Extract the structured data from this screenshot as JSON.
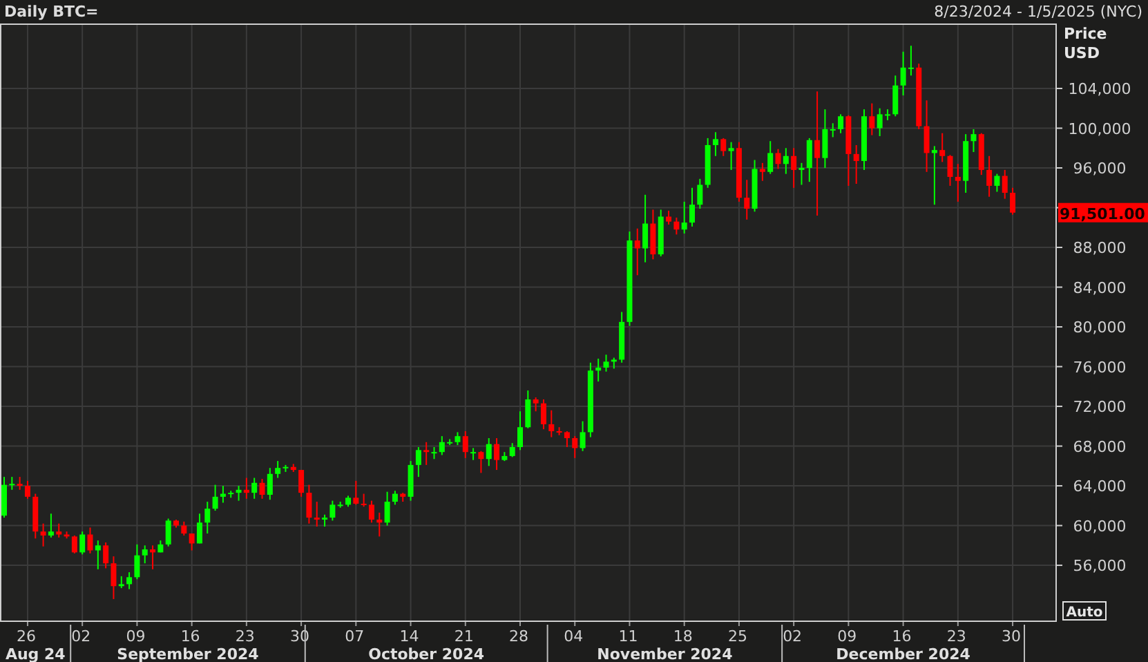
{
  "header": {
    "title": "Daily BTC=",
    "date_range": "8/23/2024 - 1/5/2025 (NYC)"
  },
  "price_axis": {
    "title": "Price",
    "unit": "USD",
    "last_price": "91,501.00"
  },
  "date_axis": {
    "months": [
      "Aug 24",
      "September 2024",
      "October 2024",
      "November 2024",
      "December 2024"
    ]
  },
  "auto_button": "Auto",
  "chart_data": {
    "type": "candlestick",
    "grid": true,
    "ylim": [
      50300,
      110540
    ],
    "yticks": [
      {
        "value": 104000,
        "label": "104,000"
      },
      {
        "value": 100000,
        "label": "100,000"
      },
      {
        "value": 96000,
        "label": "96,000"
      },
      {
        "value": 88000,
        "label": "88,000"
      },
      {
        "value": 84000,
        "label": "84,000"
      },
      {
        "value": 80000,
        "label": "80,000"
      },
      {
        "value": 76000,
        "label": "76,000"
      },
      {
        "value": 72000,
        "label": "72,000"
      },
      {
        "value": 68000,
        "label": "68,000"
      },
      {
        "value": 64000,
        "label": "64,000"
      },
      {
        "value": 60000,
        "label": "60,000"
      },
      {
        "value": 56000,
        "label": "56,000"
      }
    ],
    "categories": [
      null,
      null,
      null,
      "26",
      null,
      null,
      null,
      null,
      null,
      null,
      "02",
      null,
      null,
      null,
      null,
      null,
      null,
      "09",
      null,
      null,
      null,
      null,
      null,
      null,
      "16",
      null,
      null,
      null,
      null,
      null,
      null,
      "23",
      null,
      null,
      null,
      null,
      null,
      null,
      "30",
      null,
      null,
      null,
      null,
      null,
      null,
      "07",
      null,
      null,
      null,
      null,
      null,
      null,
      "14",
      null,
      null,
      null,
      null,
      null,
      null,
      "21",
      null,
      null,
      null,
      null,
      null,
      null,
      "28",
      null,
      null,
      null,
      null,
      null,
      null,
      "04",
      null,
      null,
      null,
      null,
      null,
      null,
      "11",
      null,
      null,
      null,
      null,
      null,
      null,
      "18",
      null,
      null,
      null,
      null,
      null,
      null,
      "25",
      null,
      null,
      null,
      null,
      null,
      null,
      "02",
      null,
      null,
      null,
      null,
      null,
      null,
      "09",
      null,
      null,
      null,
      null,
      null,
      null,
      "16",
      null,
      null,
      null,
      null,
      null,
      null,
      "23",
      null,
      null,
      null,
      null,
      null,
      null,
      "30"
    ],
    "ohlc": [
      [
        61000,
        64900,
        60800,
        64100
      ],
      [
        64100,
        64900,
        63600,
        64200
      ],
      [
        64200,
        64900,
        63600,
        64000
      ],
      [
        64000,
        64500,
        62700,
        62900
      ],
      [
        62900,
        63200,
        58700,
        59400
      ],
      [
        59400,
        60200,
        57900,
        59000
      ],
      [
        59000,
        61200,
        58800,
        59400
      ],
      [
        59400,
        60200,
        58800,
        59100
      ],
      [
        59100,
        59400,
        58700,
        58900
      ],
      [
        58900,
        59000,
        57200,
        57300
      ],
      [
        57300,
        59400,
        57100,
        59100
      ],
      [
        59100,
        59800,
        57200,
        57500
      ],
      [
        57500,
        58500,
        55600,
        58000
      ],
      [
        58000,
        58300,
        55700,
        56200
      ],
      [
        56200,
        56900,
        52600,
        53900
      ],
      [
        53900,
        54900,
        53700,
        54100
      ],
      [
        54100,
        55300,
        53600,
        54800
      ],
      [
        54800,
        58100,
        54600,
        57000
      ],
      [
        57000,
        58000,
        56200,
        57600
      ],
      [
        57600,
        58000,
        55600,
        57300
      ],
      [
        57300,
        58500,
        57300,
        58100
      ],
      [
        58100,
        60700,
        57900,
        60500
      ],
      [
        60500,
        60600,
        59800,
        60000
      ],
      [
        60000,
        60400,
        59000,
        59200
      ],
      [
        59200,
        59200,
        57500,
        58200
      ],
      [
        58200,
        61200,
        58200,
        60300
      ],
      [
        60300,
        62400,
        59200,
        61700
      ],
      [
        61700,
        64100,
        61500,
        62900
      ],
      [
        62900,
        64000,
        62300,
        63200
      ],
      [
        63200,
        63500,
        62800,
        63300
      ],
      [
        63300,
        64000,
        62500,
        63600
      ],
      [
        63600,
        64800,
        62700,
        63300
      ],
      [
        63300,
        64800,
        62700,
        64300
      ],
      [
        64300,
        64700,
        62700,
        63100
      ],
      [
        63100,
        65800,
        62600,
        65200
      ],
      [
        65200,
        66500,
        64800,
        65800
      ],
      [
        65800,
        66100,
        65400,
        65900
      ],
      [
        65900,
        66200,
        65400,
        65600
      ],
      [
        65600,
        65600,
        62900,
        63300
      ],
      [
        63300,
        64100,
        60200,
        60800
      ],
      [
        60800,
        62400,
        59900,
        60600
      ],
      [
        60600,
        61100,
        59900,
        60800
      ],
      [
        60800,
        62500,
        60500,
        62100
      ],
      [
        62100,
        62400,
        61800,
        62100
      ],
      [
        62100,
        63000,
        61900,
        62800
      ],
      [
        62800,
        64500,
        62100,
        62200
      ],
      [
        62200,
        63200,
        61900,
        62100
      ],
      [
        62100,
        62500,
        60300,
        60600
      ],
      [
        60600,
        61300,
        58900,
        60300
      ],
      [
        60300,
        63400,
        60000,
        62400
      ],
      [
        62400,
        63500,
        62100,
        63200
      ],
      [
        63200,
        63300,
        62400,
        62900
      ],
      [
        62900,
        66500,
        62500,
        66100
      ],
      [
        66100,
        67900,
        64900,
        67600
      ],
      [
        67600,
        68400,
        66100,
        67400
      ],
      [
        67400,
        67900,
        66700,
        67400
      ],
      [
        67400,
        69000,
        67100,
        68400
      ],
      [
        68400,
        68700,
        68100,
        68400
      ],
      [
        68400,
        69400,
        68100,
        69000
      ],
      [
        69000,
        69500,
        66800,
        67400
      ],
      [
        67400,
        67800,
        66600,
        67400
      ],
      [
        67400,
        67500,
        65300,
        66700
      ],
      [
        66700,
        68800,
        66000,
        68200
      ],
      [
        68200,
        68800,
        65600,
        66600
      ],
      [
        66600,
        67400,
        66500,
        67000
      ],
      [
        67000,
        68300,
        66900,
        67900
      ],
      [
        67900,
        71500,
        67600,
        69900
      ],
      [
        69900,
        73600,
        69800,
        72700
      ],
      [
        72700,
        72900,
        71500,
        72300
      ],
      [
        72300,
        72700,
        69700,
        70200
      ],
      [
        70200,
        71600,
        68900,
        69500
      ],
      [
        69500,
        69900,
        69100,
        69400
      ],
      [
        69400,
        69500,
        67900,
        68800
      ],
      [
        68800,
        69000,
        66800,
        67800
      ],
      [
        67800,
        70500,
        67500,
        69400
      ],
      [
        69400,
        76400,
        68900,
        75600
      ],
      [
        75600,
        76800,
        74500,
        75900
      ],
      [
        75900,
        77200,
        75500,
        76500
      ],
      [
        76500,
        76900,
        75800,
        76700
      ],
      [
        76700,
        81500,
        76400,
        80500
      ],
      [
        80500,
        89600,
        80100,
        88700
      ],
      [
        88700,
        89900,
        85200,
        87900
      ],
      [
        87900,
        93300,
        86500,
        90400
      ],
      [
        90400,
        91800,
        86800,
        87300
      ],
      [
        87300,
        91800,
        87100,
        91100
      ],
      [
        91100,
        91700,
        90300,
        90600
      ],
      [
        90600,
        91000,
        89300,
        89800
      ],
      [
        89800,
        92600,
        89400,
        90500
      ],
      [
        90500,
        94000,
        90100,
        92300
      ],
      [
        92300,
        94900,
        91900,
        94300
      ],
      [
        94300,
        99000,
        94000,
        98300
      ],
      [
        98300,
        99600,
        97200,
        98900
      ],
      [
        98900,
        99000,
        97200,
        97700
      ],
      [
        97700,
        98600,
        95800,
        98000
      ],
      [
        98000,
        98600,
        92600,
        93000
      ],
      [
        93000,
        94800,
        90800,
        91900
      ],
      [
        91900,
        96800,
        91600,
        95900
      ],
      [
        95900,
        96500,
        94700,
        95600
      ],
      [
        95600,
        98700,
        95400,
        97500
      ],
      [
        97500,
        97900,
        95900,
        96400
      ],
      [
        96400,
        98000,
        95400,
        97200
      ],
      [
        97200,
        98000,
        94000,
        95800
      ],
      [
        95800,
        96500,
        94300,
        96000
      ],
      [
        96000,
        99000,
        94600,
        98800
      ],
      [
        98800,
        103700,
        91200,
        97000
      ],
      [
        97000,
        101900,
        96000,
        99900
      ],
      [
        99900,
        100500,
        99100,
        99900
      ],
      [
        99900,
        101400,
        99500,
        101200
      ],
      [
        101200,
        101300,
        94200,
        97400
      ],
      [
        97400,
        98300,
        94400,
        96700
      ],
      [
        96700,
        101900,
        95800,
        101200
      ],
      [
        101200,
        102500,
        99300,
        100000
      ],
      [
        100000,
        102000,
        99200,
        101400
      ],
      [
        101400,
        101900,
        100800,
        101400
      ],
      [
        101400,
        105300,
        101200,
        104300
      ],
      [
        104300,
        107700,
        103300,
        106100
      ],
      [
        106100,
        108300,
        105300,
        106100
      ],
      [
        106100,
        106500,
        99900,
        100200
      ],
      [
        100200,
        102800,
        95600,
        97500
      ],
      [
        97500,
        98200,
        92300,
        97800
      ],
      [
        97800,
        99500,
        96600,
        97200
      ],
      [
        97200,
        97300,
        94200,
        95100
      ],
      [
        95100,
        96400,
        92600,
        94700
      ],
      [
        94700,
        99400,
        93500,
        98700
      ],
      [
        98700,
        99900,
        97600,
        99400
      ],
      [
        99400,
        99500,
        95300,
        95800
      ],
      [
        95800,
        97200,
        93100,
        94200
      ],
      [
        94200,
        95400,
        93600,
        95200
      ],
      [
        95200,
        95800,
        92900,
        93500
      ],
      [
        93500,
        94000,
        91300,
        91501
      ]
    ]
  }
}
